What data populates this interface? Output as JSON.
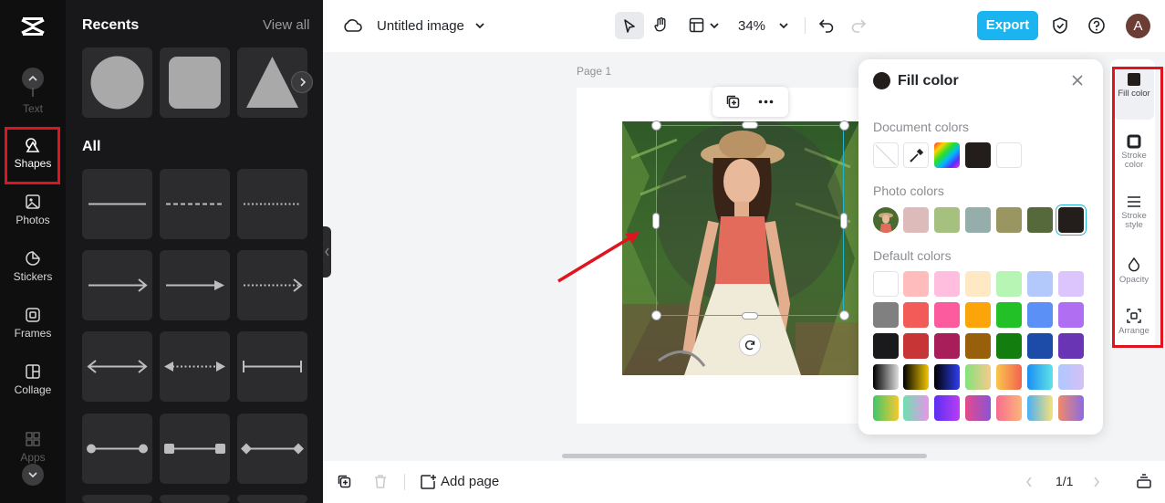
{
  "rail": {
    "items": [
      {
        "label": "Text",
        "icon": "text-icon"
      },
      {
        "label": "Shapes",
        "icon": "shapes-icon"
      },
      {
        "label": "Photos",
        "icon": "photos-icon"
      },
      {
        "label": "Stickers",
        "icon": "stickers-icon"
      },
      {
        "label": "Frames",
        "icon": "frames-icon"
      },
      {
        "label": "Collage",
        "icon": "collage-icon"
      },
      {
        "label": "Apps",
        "icon": "apps-icon"
      }
    ],
    "active": "Shapes",
    "highlight_color": "#e0141e"
  },
  "panel": {
    "recents_title": "Recents",
    "view_all": "View all",
    "recents": [
      "circle",
      "rounded-square",
      "triangle"
    ],
    "all_title": "All",
    "shapes": [
      "solid-line",
      "dashed-line",
      "dotted-line",
      "arrow-line",
      "solid-arrow",
      "dotted-arrow",
      "double-arrow",
      "dotted-double-arrow",
      "bracket-line",
      "circle-ends-line",
      "square-ends-line",
      "diamond-ends-line"
    ]
  },
  "topbar": {
    "title": "Untitled image",
    "zoom": "34%",
    "export": "Export",
    "avatar": "A",
    "accent": "#1ab4f0"
  },
  "canvas": {
    "page_label": "Page 1"
  },
  "fill_popover": {
    "title": "Fill color",
    "current_color": "#231d1b",
    "document_colors_title": "Document colors",
    "document_colors": [
      "none",
      "eyedropper",
      "picker",
      "#231d1b",
      "#ffffff"
    ],
    "photo_colors_title": "Photo colors",
    "photo_colors": [
      "photo",
      "#ddbbbb",
      "#a5c07f",
      "#95aeab",
      "#9a9662",
      "#55693a",
      "#231d1b"
    ],
    "default_colors_title": "Default colors",
    "default_colors": [
      [
        "#ffffff",
        "#ffbcbc",
        "#ffbedd",
        "#ffe9c4",
        "#b7f5b5",
        "#b3c8fb",
        "#dcc5fc"
      ],
      [
        "#808080",
        "#f25b57",
        "#fc5c9d",
        "#fca50a",
        "#22c128",
        "#5b90f6",
        "#b06ff3"
      ],
      [
        "#1a1a1d",
        "#c73536",
        "#a81e5b",
        "#98600b",
        "#137d10",
        "#1c4ca8",
        "#6a35b5"
      ]
    ],
    "gradient_colors": [
      [
        "#000000",
        "#dddddd"
      ],
      [
        "#000000",
        "#f3c700"
      ],
      [
        "#000000",
        "#2e3ef2"
      ],
      [
        "#83e37c",
        "#f7c98a"
      ],
      [
        "#f9c64c",
        "#f3634f"
      ],
      [
        "#1b8ff2",
        "#5fe3e8"
      ],
      [
        "#aec8ff",
        "#d5c0f5"
      ],
      [
        "#3ec76a",
        "#f5c830"
      ],
      [
        "#6ee0b1",
        "#e696e8"
      ],
      [
        "#5b2ef2",
        "#b93ef5"
      ],
      [
        "#e54a8b",
        "#8c53d6"
      ],
      [
        "#f76d8f",
        "#fcb57a"
      ],
      [
        "#4ab0f7",
        "#f7e17a"
      ],
      [
        "#f08a6a",
        "#8b6be0"
      ]
    ]
  },
  "props": {
    "items": [
      {
        "label": "Fill color",
        "icon": "fill-color-icon"
      },
      {
        "label": "Stroke color",
        "icon": "stroke-color-icon"
      },
      {
        "label": "Stroke style",
        "icon": "stroke-style-icon"
      },
      {
        "label": "Opacity",
        "icon": "opacity-icon"
      },
      {
        "label": "Arrange",
        "icon": "arrange-icon"
      }
    ],
    "active": "Fill color"
  },
  "bottombar": {
    "add_page": "Add page",
    "page_count": "1/1"
  }
}
